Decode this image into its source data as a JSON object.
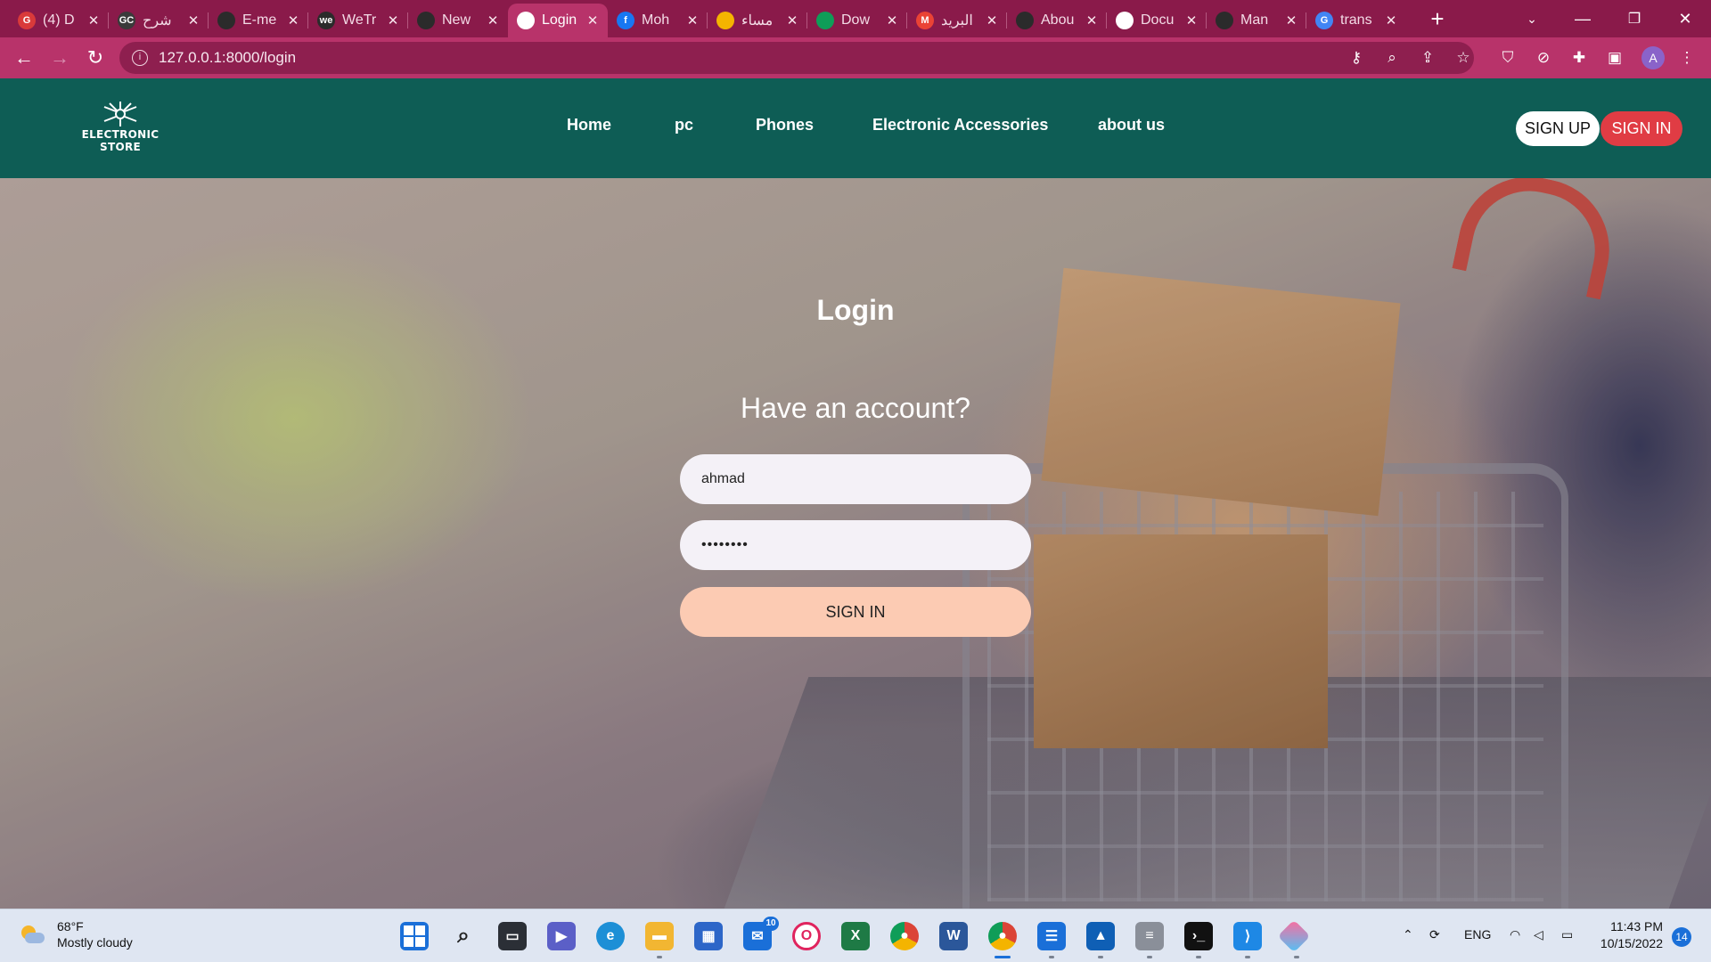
{
  "browser": {
    "tabs": [
      {
        "title": "(4) D",
        "icon": "mail-badge-icon",
        "color": "#d93a3a",
        "glyph": "G"
      },
      {
        "title": "شرح",
        "icon": "gc-icon",
        "color": "#3a3a3a",
        "glyph": "GC"
      },
      {
        "title": "E-me",
        "icon": "github-icon",
        "color": "#2b2b2b",
        "glyph": ""
      },
      {
        "title": "WeTr",
        "icon": "wetransfer-icon",
        "color": "#2b2b2b",
        "glyph": "we"
      },
      {
        "title": "New",
        "icon": "github-icon",
        "color": "#2b2b2b",
        "glyph": ""
      },
      {
        "title": "Login",
        "icon": "globe-icon",
        "color": "#ffffff",
        "glyph": ""
      },
      {
        "title": "Moh",
        "icon": "facebook-icon",
        "color": "#1877f2",
        "glyph": "f"
      },
      {
        "title": "مساء",
        "icon": "drive-icon",
        "color": "#f4b400",
        "glyph": ""
      },
      {
        "title": "Dow",
        "icon": "drive-icon",
        "color": "#0f9d58",
        "glyph": ""
      },
      {
        "title": "البريد",
        "icon": "gmail-icon",
        "color": "#ea4335",
        "glyph": "M"
      },
      {
        "title": "Abou",
        "icon": "github-icon",
        "color": "#2b2b2b",
        "glyph": ""
      },
      {
        "title": "Docu",
        "icon": "globe-icon",
        "color": "#ffffff",
        "glyph": ""
      },
      {
        "title": "Man",
        "icon": "github-icon",
        "color": "#2b2b2b",
        "glyph": ""
      },
      {
        "title": "trans",
        "icon": "google-icon",
        "color": "#4285f4",
        "glyph": "G"
      }
    ],
    "active_tab_index": 5,
    "url": "127.0.0.1:8000/login",
    "profile_initial": "A"
  },
  "site": {
    "logo_line1": "ELECTRONIC",
    "logo_line2": "STORE",
    "nav": [
      "Home",
      "pc",
      "Phones",
      "Electronic Accessories",
      "about us"
    ],
    "signup_label": "SIGN UP",
    "signin_label": "SIGN IN",
    "colors": {
      "header": "#0e5d55",
      "signin": "#e03c44",
      "login_button": "#fccbb3"
    }
  },
  "login": {
    "title": "Login",
    "subtitle": "Have an account?",
    "username_value": "ahmad",
    "password_value": "••••••••",
    "submit_label": "SIGN IN"
  },
  "taskbar": {
    "weather_temp": "68°F",
    "weather_desc": "Mostly cloudy",
    "mail_badge": "10",
    "language": "ENG",
    "time": "11:43 PM",
    "date": "10/15/2022",
    "notification_count": "14"
  }
}
